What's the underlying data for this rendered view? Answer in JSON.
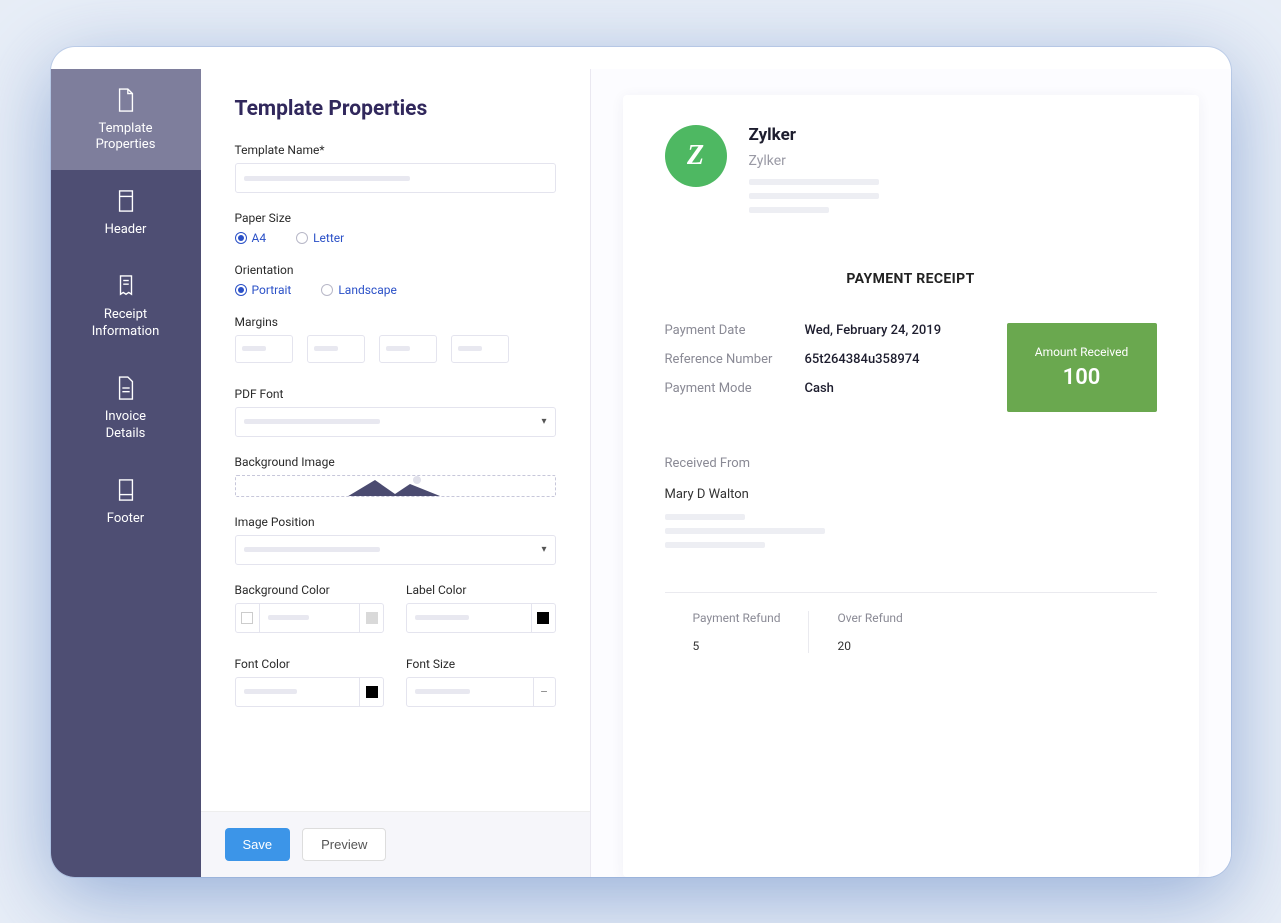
{
  "sidebar": {
    "items": [
      {
        "label": "Template\nProperties"
      },
      {
        "label": "Header"
      },
      {
        "label": "Receipt\nInformation"
      },
      {
        "label": "Invoice\nDetails"
      },
      {
        "label": "Footer"
      }
    ]
  },
  "form": {
    "title": "Template Properties",
    "templateName_label": "Template Name*",
    "paperSize_label": "Paper Size",
    "paperSize_a4": "A4",
    "paperSize_letter": "Letter",
    "orientation_label": "Orientation",
    "orientation_portrait": "Portrait",
    "orientation_landscape": "Landscape",
    "margins_label": "Margins",
    "pdfFont_label": "PDF Font",
    "bgImage_label": "Background Image",
    "imgPosition_label": "Image Position",
    "bgColor_label": "Background Color",
    "labelColor_label": "Label Color",
    "fontColor_label": "Font Color",
    "fontSize_label": "Font Size",
    "bgColor_value": "#ffffff",
    "labelColor_value": "#000000",
    "fontColor_value": "#000000"
  },
  "buttons": {
    "save": "Save",
    "preview": "Preview"
  },
  "preview": {
    "company": "Zylker",
    "company_sub": "Zylker",
    "doc_title": "PAYMENT RECEIPT",
    "paymentDate_label": "Payment Date",
    "paymentDate_value": "Wed, February 24, 2019",
    "refNum_label": "Reference Number",
    "refNum_value": "65t264384u358974",
    "paymentMode_label": "Payment Mode",
    "paymentMode_value": "Cash",
    "amountReceived_label": "Amount Received",
    "amountReceived_value": "100",
    "receivedFrom_label": "Received From",
    "receivedFrom_name": "Mary D Walton",
    "paymentRefund_label": "Payment Refund",
    "paymentRefund_value": "5",
    "overRefund_label": "Over Refund",
    "overRefund_value": "20"
  }
}
